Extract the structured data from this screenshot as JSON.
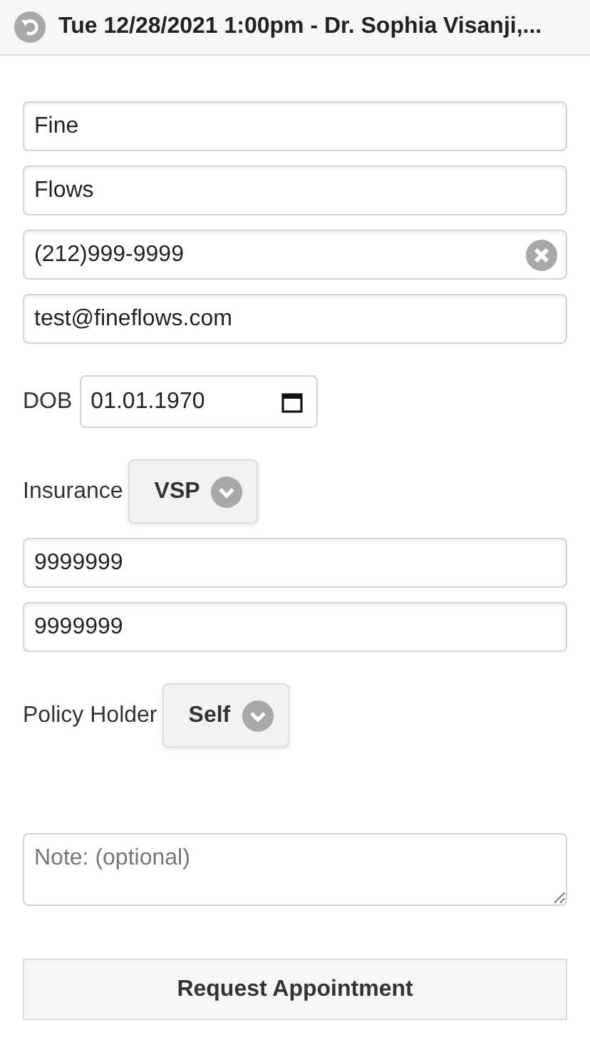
{
  "header": {
    "title": "Tue 12/28/2021 1:00pm - Dr. Sophia Visanji,..."
  },
  "fields": [
    {
      "kind": "text",
      "value": "Fine",
      "clearable": false
    },
    {
      "kind": "text",
      "value": "Flows",
      "clearable": false
    },
    {
      "kind": "text",
      "value": "(212)999-9999",
      "clearable": true
    },
    {
      "kind": "text",
      "value": "test@fineflows.com",
      "clearable": false
    },
    {
      "kind": "date",
      "label": "DOB",
      "value": "01.01.1970"
    },
    {
      "kind": "select",
      "label": "Insurance",
      "value": "VSP"
    },
    {
      "kind": "text",
      "value": "9999999",
      "clearable": false
    },
    {
      "kind": "text",
      "value": "9999999",
      "clearable": false
    },
    {
      "kind": "select",
      "label": "Policy Holder",
      "value": "Self"
    },
    {
      "kind": "textarea",
      "placeholder": "Note: (optional)"
    }
  ],
  "submit_button": {
    "label": "Request Appointment"
  }
}
